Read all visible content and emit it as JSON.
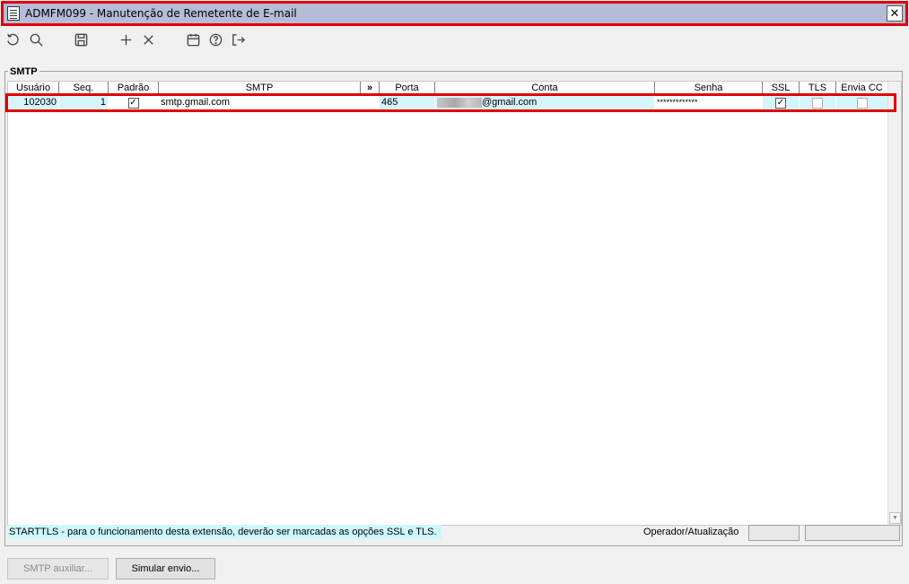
{
  "window": {
    "title": "ADMFM099 - Manutenção de Remetente de E-mail",
    "close_label": "✕"
  },
  "toolbar": {
    "icons": [
      "undo-icon",
      "search-icon",
      "save-icon",
      "add-icon",
      "delete-icon",
      "calendar-icon",
      "help-icon",
      "exit-icon"
    ]
  },
  "group": {
    "label": "SMTP"
  },
  "grid": {
    "columns": [
      "Usuário",
      "Seq.",
      "Padrão",
      "SMTP",
      "»",
      "Porta",
      "Conta",
      "Senha",
      "SSL",
      "TLS",
      "Envia CC"
    ],
    "rows": [
      {
        "usuario": "102030",
        "seq": "1",
        "padrao": true,
        "smtp": "smtp.gmail.com",
        "porta": "465",
        "conta_suffix": "@gmail.com",
        "senha": "*************",
        "ssl": true,
        "tls": false,
        "envia_cc": false
      }
    ]
  },
  "status": {
    "hint": "STARTTLS - para o funcionamento desta extensão, deverão ser marcadas as opções SSL e TLS.",
    "operator_label": "Operador/Atualização"
  },
  "buttons": {
    "smtp_aux": "SMTP auxiliar...",
    "simular": "Simular envio..."
  },
  "colors": {
    "title_bg": "#b4bcd8",
    "highlight": "#e00000",
    "row_bg": "#d6f4fb",
    "hint_bg": "#cdf7fd"
  }
}
